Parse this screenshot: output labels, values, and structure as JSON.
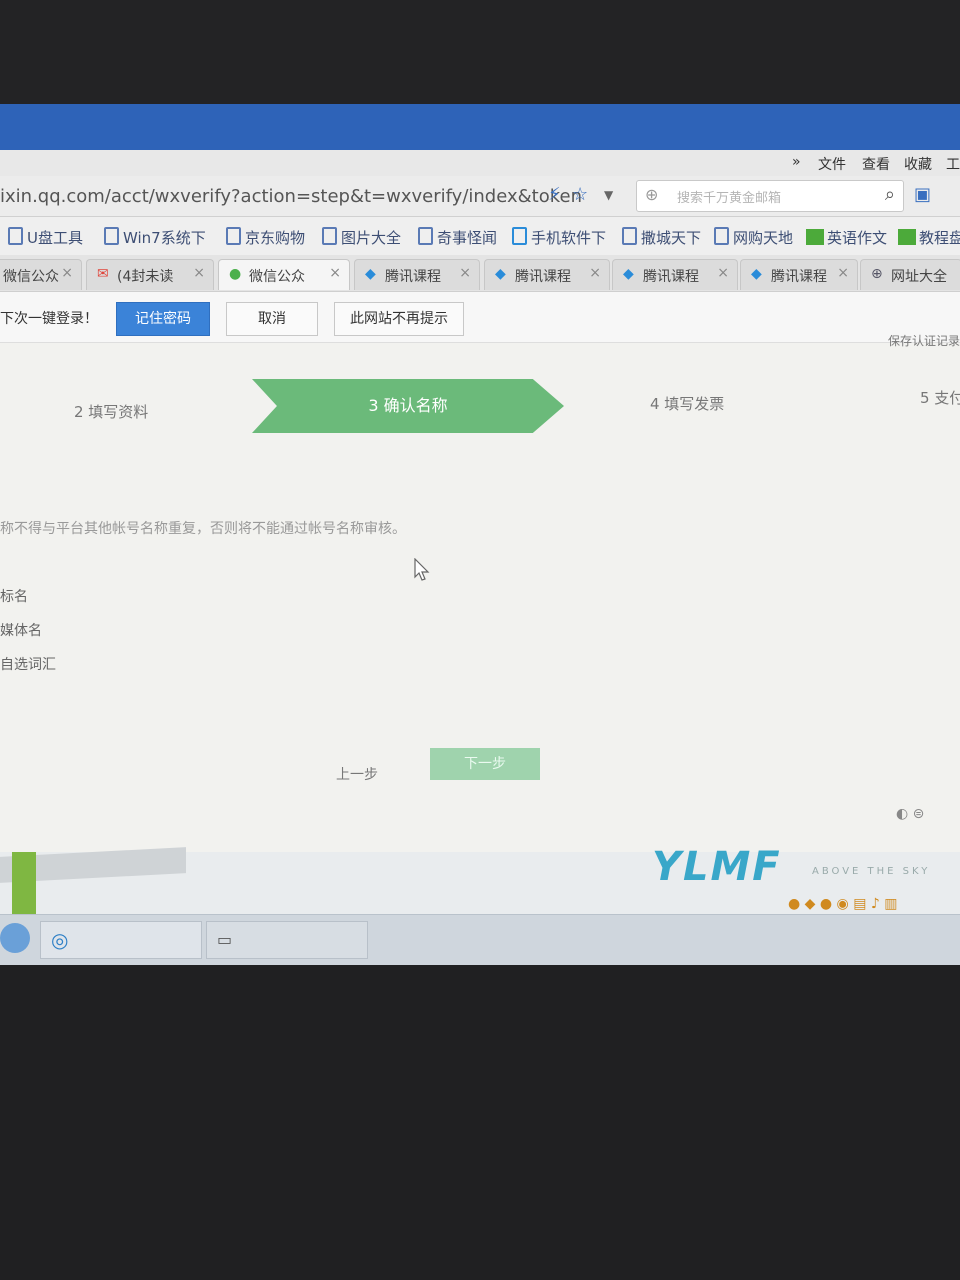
{
  "browser": {
    "menu": {
      "more": "»",
      "file": "文件",
      "view": "查看",
      "favorites": "收藏",
      "tools": "工"
    },
    "url": "ixin.qq.com/acct/wxverify?action=step&t=wxverify/index&token",
    "search_placeholder": "搜索千万黄金邮箱",
    "bookmarks": [
      "U盘工具",
      "Win7系统下",
      "京东购物",
      "图片大全",
      "奇事怪闻",
      "手机软件下",
      "撒城天下",
      "网购天地",
      "英语作文",
      "教程盘"
    ],
    "tabs": [
      "微信公众",
      "(4封未读",
      "微信公众",
      "腾讯课程",
      "腾讯课程",
      "腾讯课程",
      "腾讯课程",
      "网址大全"
    ]
  },
  "password_bar": {
    "message": "下次一键登录！",
    "remember_label": "记住密码",
    "cancel_label": "取消",
    "never_label": "此网站不再提示",
    "corner_text": "保存认证记录"
  },
  "steps": {
    "step2": "2 填写资料",
    "step3": "3 确认名称",
    "step4": "4 填写发票",
    "step5": "5 支付"
  },
  "content": {
    "notice": "称不得与平台其他帐号名称重复，否则将不能通过帐号名称审核。",
    "options": [
      "标名",
      "媒体名",
      "自选词汇"
    ],
    "prev_label": "上一步",
    "next_label": "下一步"
  },
  "desktop": {
    "logo": "YLMF",
    "logo_tagline": "ABOVE THE SKY"
  }
}
